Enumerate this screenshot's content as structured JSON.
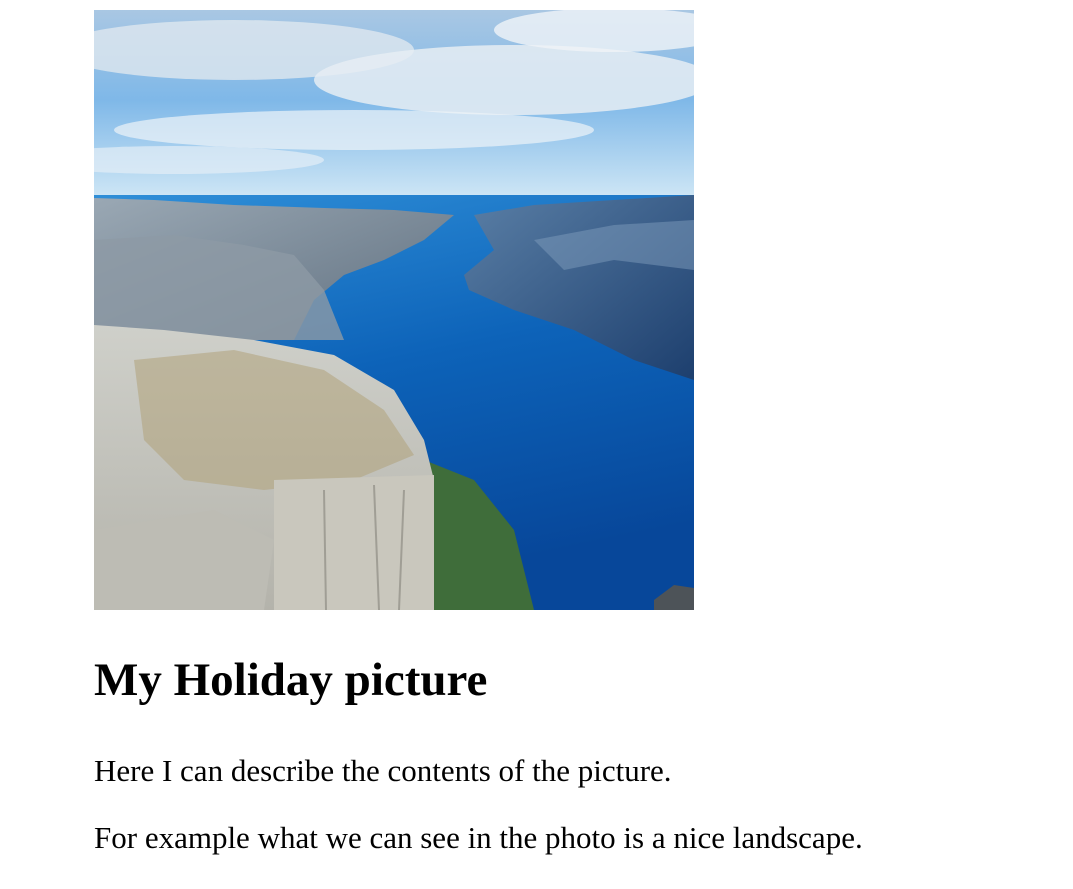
{
  "article": {
    "image": {
      "subject": "fjord landscape",
      "colors": {
        "sky": "#8fc4ec",
        "water": "#0b5fb2",
        "rock": "#c7c8c3",
        "vegetation": "#9a8a3c"
      }
    },
    "heading": "My Holiday picture",
    "paragraphs": [
      "Here I can describe the contents of the picture.",
      "For example what we can see in the photo is a nice landscape."
    ]
  }
}
